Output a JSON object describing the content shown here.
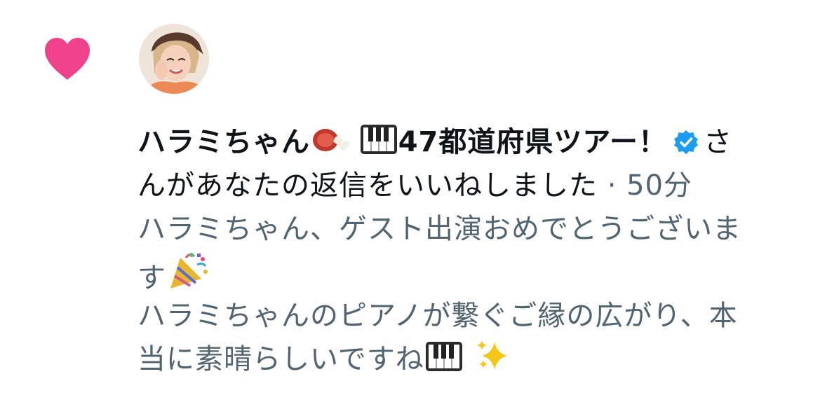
{
  "notification": {
    "type_icon": "heart-icon",
    "avatar_icon": "user-avatar",
    "user": {
      "display_name": "ハラミちゃん",
      "tour_text": "47都道府県ツアー！",
      "name_emojis": [
        "meat-on-bone-icon",
        "piano-keys-icon"
      ],
      "verified": true,
      "verified_icon": "verified-badge-icon"
    },
    "action_suffix": "さ",
    "action_text": "んがあなたの返信をいいねしました",
    "separator": " · ",
    "time": "50分",
    "reply": {
      "line1": "ハラミちゃん、ゲスト出演おめでとうございま",
      "line2": "す",
      "line2_emoji": "party-popper-icon",
      "line3": "ハラミちゃんのピアノが繋ぐご縁の広がり、本",
      "line4": "当に素晴らしいですね",
      "line4_emojis": [
        "piano-keys-icon",
        "sparkles-icon"
      ]
    },
    "colors": {
      "heart": "#f0428a",
      "verified": "#1d9bf0",
      "primary_text": "#0f1419",
      "secondary_text": "#536471"
    }
  }
}
